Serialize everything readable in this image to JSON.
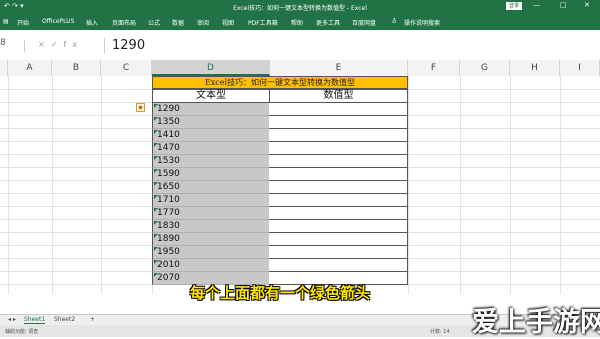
{
  "window": {
    "title": "Excel技巧：如何一键文本型转换为数值型 - Excel",
    "login_label": "登录",
    "controls": [
      "—",
      "□",
      "✕"
    ]
  },
  "ribbon": {
    "file_icon": "file-icon",
    "tabs": [
      "开始",
      "OfficePLUS",
      "插入",
      "页面布局",
      "公式",
      "数据",
      "审阅",
      "视图",
      "PDF工具箱",
      "帮助",
      "更多工具",
      "百度网盘"
    ],
    "search_hint": "操作说明搜索"
  },
  "formula_bar": {
    "name_box": "8",
    "icons": [
      "×",
      "✓",
      "fx"
    ],
    "value": "1290"
  },
  "columns": [
    {
      "label": "A",
      "selected": false
    },
    {
      "label": "B",
      "selected": false
    },
    {
      "label": "C",
      "selected": false
    },
    {
      "label": "D",
      "selected": true
    },
    {
      "label": "E",
      "selected": false
    },
    {
      "label": "F",
      "selected": false
    },
    {
      "label": "G",
      "selected": false
    },
    {
      "label": "H",
      "selected": false
    },
    {
      "label": "I",
      "selected": false
    }
  ],
  "sheet": {
    "banner": "Excel技巧：如何一键文本型转换为数值型",
    "header_text": "文本型",
    "header_number": "数值型",
    "text_values": [
      "1290",
      "1350",
      "1410",
      "1470",
      "1530",
      "1590",
      "1650",
      "1710",
      "1770",
      "1830",
      "1890",
      "1950",
      "2010",
      "2070"
    ]
  },
  "paste_icon": "paste-options-icon",
  "subtitle": "每个上面都有一个绿色箭头",
  "sheet_tabs": [
    "Sheet1",
    "Sheet2",
    "+"
  ],
  "status": {
    "left": "辅助功能: 调查",
    "right": "计数: 14"
  },
  "watermark": "爱上手游网",
  "colors": {
    "excel_green": "#217346",
    "banner_yellow": "#ffc000",
    "selection_gray": "#c8c8c8",
    "subtitle_yellow": "#ffe500"
  }
}
